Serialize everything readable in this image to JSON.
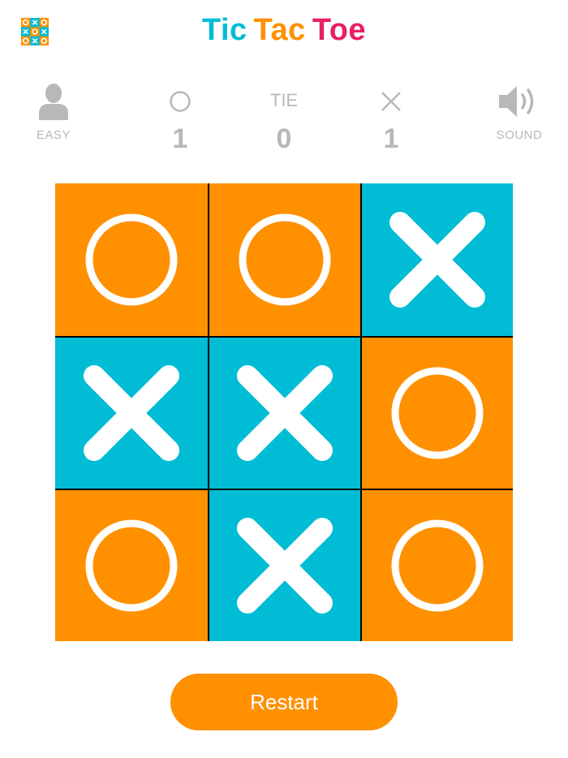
{
  "app": {
    "title_words": [
      "Tic",
      "Tac",
      "Toe"
    ],
    "title_colors": [
      "#00bcd4",
      "#ff9000",
      "#e91e63"
    ]
  },
  "colors": {
    "o_tile": "#ff9000",
    "x_tile": "#00bcd4",
    "mark": "#ffffff",
    "muted": "#b8b8b8"
  },
  "scoreboard": {
    "difficulty_label": "EASY",
    "o_score": "1",
    "tie_label": "TIE",
    "tie_score": "0",
    "x_score": "1",
    "sound_label": "SOUND"
  },
  "board": {
    "cells": [
      "O",
      "O",
      "X",
      "X",
      "X",
      "O",
      "O",
      "X",
      "O"
    ]
  },
  "restart_label": "Restart"
}
